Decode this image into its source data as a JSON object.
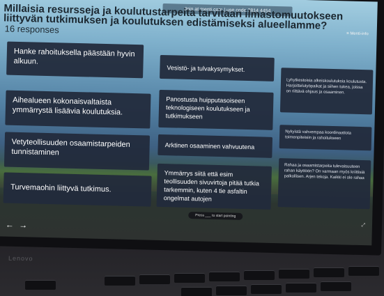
{
  "banner": {
    "text": "Join at menti.com | use code 2814 4454"
  },
  "menu_hint": "≡ Menti-info",
  "question": {
    "title": "Millaisia resursseja ja koulutustarpeita tarvitaan ilmastomuutokseen liittyvän tutkimuksen ja koulutuksen edistämiseksi alueellamme?",
    "responses": "16 responses"
  },
  "cards": [
    {
      "text": "Hanke rahoituksella päästään hyvin alkuun."
    },
    {
      "text": "Aihealueen kokonaisvaltaista ymmärrystä lisäävia koulutuksia."
    },
    {
      "text": "Vetyteollisuuden osaamistarpeiden tunnistaminen"
    },
    {
      "text": "Turvemaohin liittyvä tutkimus."
    },
    {
      "text": "Vesistö- ja tulvakysymykset."
    },
    {
      "text": "Panostusta huipputasoiseen teknologiseen koulutukseen ja tutkimukseen"
    },
    {
      "text": "Arktinen osaaminen vahvuutena"
    },
    {
      "text": "Ymmärrys siitä että esim teollisuuden sivuvirtoja pitää tutkia tarkemmin, kuten 4 tie asfaltin ongelmat autojen"
    },
    {
      "text": "Lyhytkestoisia alkeiskoulutuksia koulutusta. Harjoittelutyöpaikat ja siihen tukea, joissa on riittävä ohjaus ja osaaminen."
    },
    {
      "text": "Nykyistä vahvempaa koordinaatiota toimenpiteisiin ja rahoitukseen"
    },
    {
      "text": "Rahaa ja osaamistarpeita tulevaisuuteen rahan käyttöön? On varmaan myös kriittisiä palkollisen. Arjen tekoja. Kaikki ei ole rahaa"
    }
  ],
  "nav": {
    "prev": "←",
    "next": "→"
  },
  "pill": {
    "text": "Press ___ to start pointing"
  },
  "brand": "Lenovo"
}
